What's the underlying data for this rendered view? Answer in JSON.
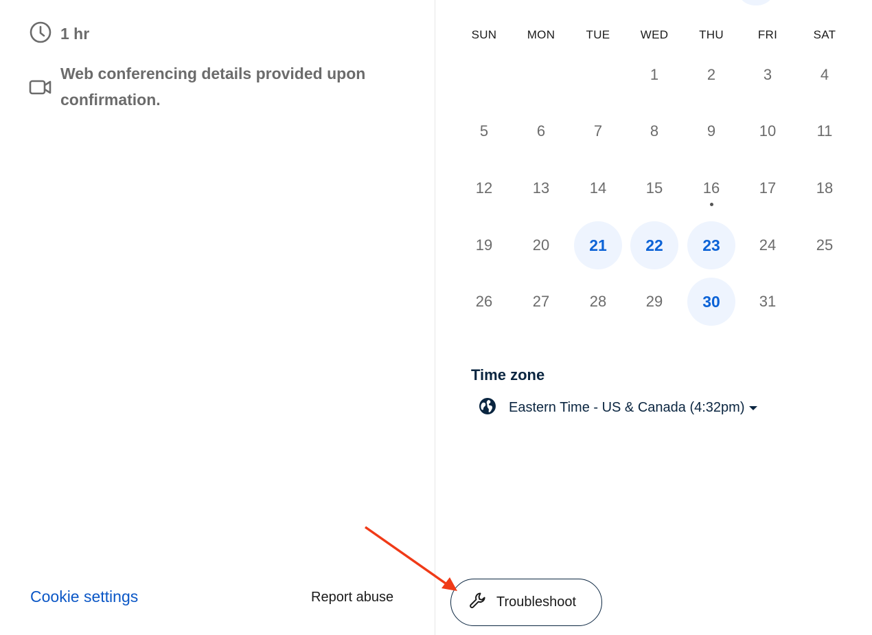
{
  "event": {
    "duration": "1 hr",
    "conferencing": [
      "Web conferencing details provided upon",
      "confirmation."
    ]
  },
  "calendar": {
    "weekdays": [
      "SUN",
      "MON",
      "TUE",
      "WED",
      "THU",
      "FRI",
      "SAT"
    ],
    "weeks": [
      [
        "",
        "",
        "",
        "1",
        "2",
        "3",
        "4"
      ],
      [
        "5",
        "6",
        "7",
        "8",
        "9",
        "10",
        "11"
      ],
      [
        "12",
        "13",
        "14",
        "15",
        "16",
        "17",
        "18"
      ],
      [
        "19",
        "20",
        "21",
        "22",
        "23",
        "24",
        "25"
      ],
      [
        "26",
        "27",
        "28",
        "29",
        "30",
        "31",
        ""
      ]
    ],
    "available_days": [
      "21",
      "22",
      "23",
      "30"
    ],
    "today_marker_day": "16"
  },
  "timezone": {
    "title": "Time zone",
    "label": "Eastern Time - US & Canada (4:32pm)"
  },
  "footer": {
    "cookie_settings": "Cookie settings",
    "report_abuse": "Report abuse",
    "troubleshoot": "Troubleshoot"
  },
  "colors": {
    "accent": "#0b62d6",
    "available_bg": "#eef4fe",
    "navy": "#0a2540",
    "annotation_arrow": "#f03a17"
  }
}
